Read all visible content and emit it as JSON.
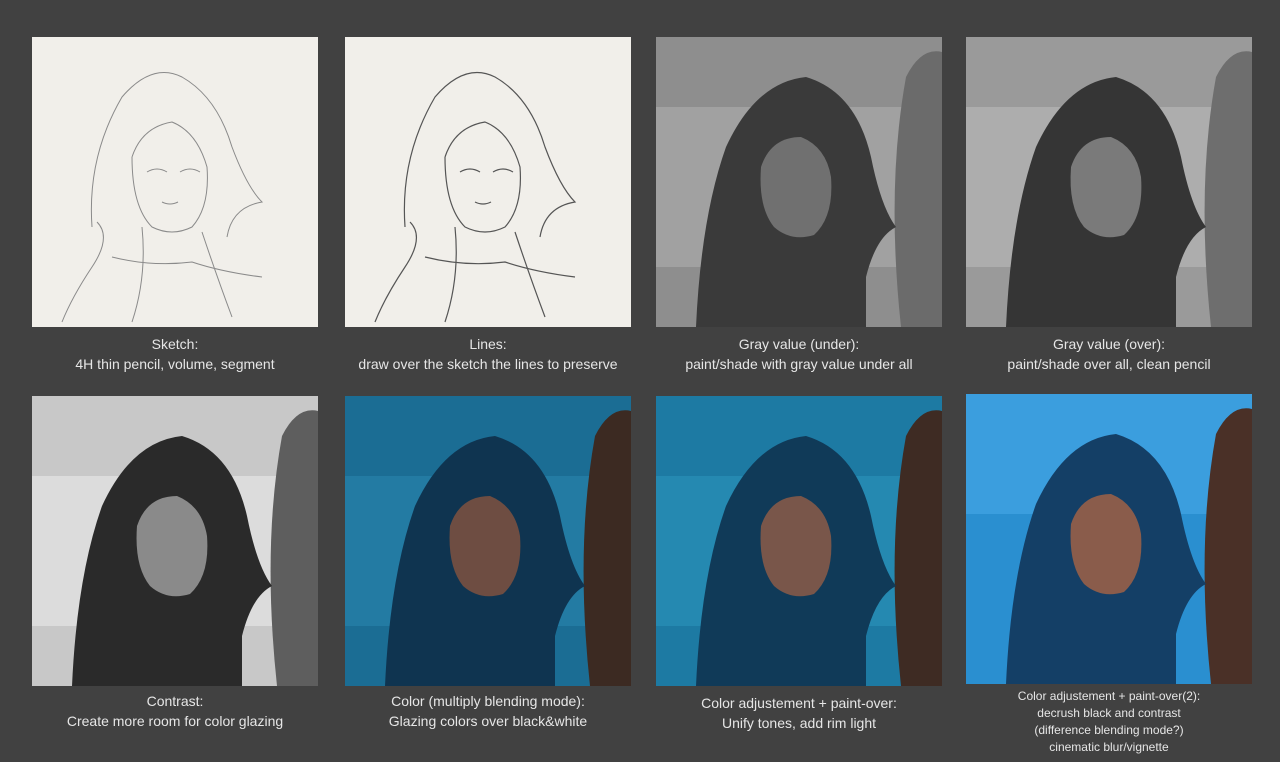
{
  "steps": [
    {
      "title": "Sketch:",
      "desc": "4H thin pencil, volume, segment"
    },
    {
      "title": "Lines:",
      "desc": "draw over the sketch the lines to preserve"
    },
    {
      "title": "Gray value (under):",
      "desc": "paint/shade with gray value under all"
    },
    {
      "title": "Gray value (over):",
      "desc": "paint/shade over all, clean pencil"
    },
    {
      "title": "Contrast:",
      "desc": "Create more room for color glazing"
    },
    {
      "title": "Color (multiply blending mode):",
      "desc": "Glazing colors over black&white"
    },
    {
      "title": "Color adjustement + paint-over:",
      "desc": "Unify tones, add rim light"
    },
    {
      "title": "Color adjustement + paint-over(2):",
      "desc": "decrush black and contrast",
      "desc2": "(difference blending mode?)",
      "desc3": "cinematic blur/vignette"
    }
  ]
}
